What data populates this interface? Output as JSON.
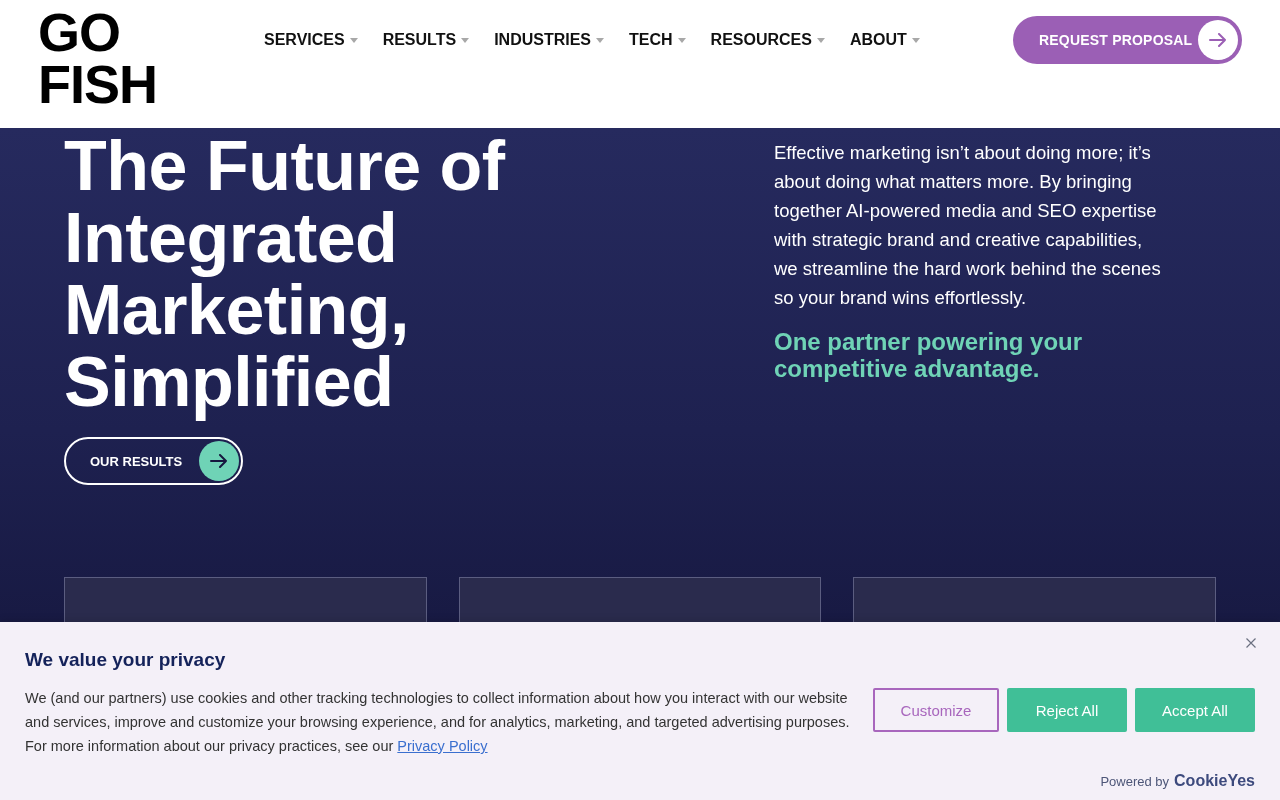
{
  "header": {
    "logo": {
      "lines": [
        "GO",
        "FISH"
      ]
    },
    "nav": [
      {
        "label": "SERVICES",
        "has_menu": true
      },
      {
        "label": "RESULTS",
        "has_menu": true
      },
      {
        "label": "INDUSTRIES",
        "has_menu": true
      },
      {
        "label": "TECH",
        "has_menu": true
      },
      {
        "label": "RESOURCES",
        "has_menu": true
      },
      {
        "label": "ABOUT",
        "has_menu": true
      }
    ],
    "cta": {
      "label": "REQUEST PROPOSAL"
    }
  },
  "hero": {
    "title": "The Future of Integrated Marketing, Simplified",
    "button": {
      "label": "OUR RESULTS"
    },
    "intro": "Effective marketing isn’t about doing more; it’s about doing what matters more. By bringing together AI-powered media and SEO expertise with strategic brand and creative capabilities, we streamline the hard work behind the scenes so your brand wins effortlessly.",
    "tagline": "One partner powering your competitive advantage."
  },
  "cookie_banner": {
    "title": "We value your privacy",
    "text": "We (and our partners) use cookies and other tracking technologies to collect information about how you interact with our website and services, improve and customize your browsing experience, and for analytics, marketing, and targeted advertising purposes. For more information about our privacy practices, see our",
    "link": "Privacy Policy",
    "buttons": [
      {
        "label": "Customize",
        "kind": "outline"
      },
      {
        "label": "Reject All",
        "kind": "filled"
      },
      {
        "label": "Accept All",
        "kind": "filled"
      }
    ],
    "powered_by": "Powered by",
    "brand": "CookieYes"
  }
}
